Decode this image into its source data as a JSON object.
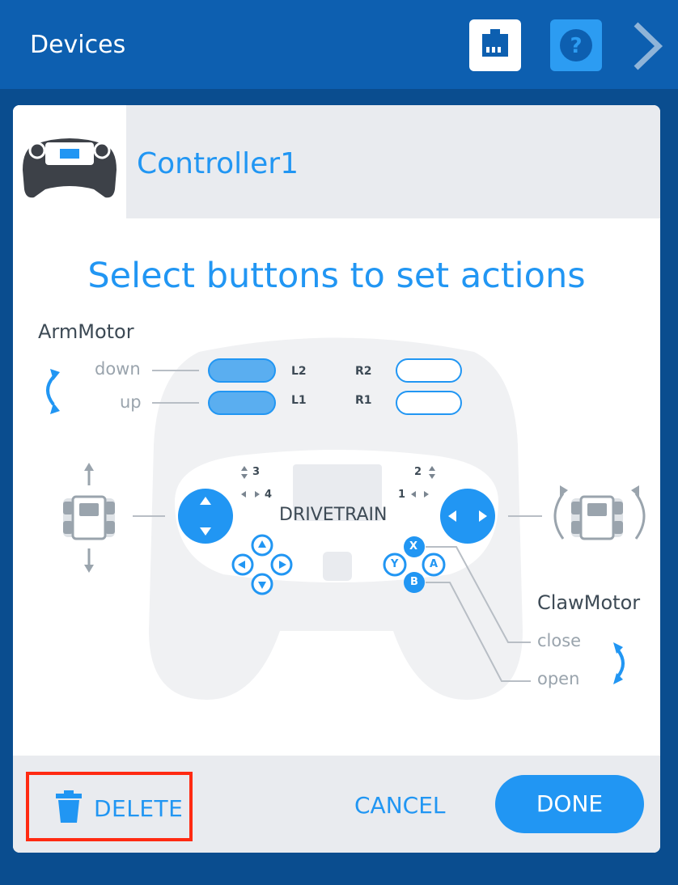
{
  "header": {
    "title": "Devices"
  },
  "device": {
    "name": "Controller1"
  },
  "instruction": "Select buttons to set actions",
  "arm_motor": {
    "label": "ArmMotor",
    "action_down": "down",
    "action_up": "up"
  },
  "claw_motor": {
    "label": "ClawMotor",
    "action_close": "close",
    "action_open": "open"
  },
  "buttons": {
    "l2": "L2",
    "l1": "L1",
    "r2": "R2",
    "r1": "R1",
    "x": "X",
    "y": "Y",
    "a": "A",
    "b": "B"
  },
  "axes": {
    "axis3": "3",
    "axis4": "4",
    "axis2": "2",
    "axis1": "1"
  },
  "drivetrain_label": "DRIVETRAIN",
  "footer": {
    "delete_label": "DELETE",
    "cancel_label": "CANCEL",
    "done_label": "DONE"
  },
  "colors": {
    "accent": "#2196f3",
    "topbar": "#0d5fb0",
    "highlight": "#ff2a12"
  }
}
